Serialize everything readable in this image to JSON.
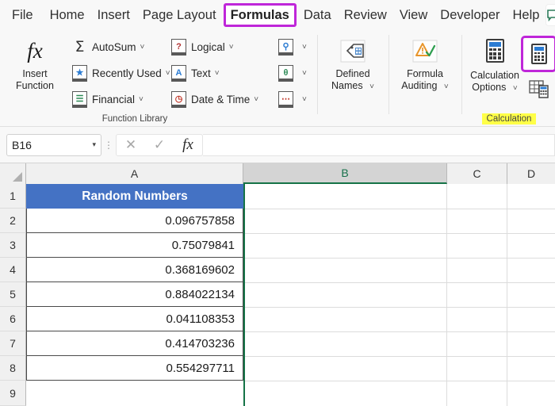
{
  "ribbon": {
    "tabs": [
      {
        "label": "File",
        "active": false
      },
      {
        "label": "Home",
        "active": false
      },
      {
        "label": "Insert",
        "active": false
      },
      {
        "label": "Page Layout",
        "active": false
      },
      {
        "label": "Formulas",
        "active": true
      },
      {
        "label": "Data",
        "active": false
      },
      {
        "label": "Review",
        "active": false
      },
      {
        "label": "View",
        "active": false
      },
      {
        "label": "Developer",
        "active": false
      },
      {
        "label": "Help",
        "active": false
      }
    ],
    "comment_icon": "comment-icon",
    "groups": {
      "function_library": {
        "label": "Function Library",
        "insert_function": {
          "line1": "Insert",
          "line2": "Function",
          "icon": "fx-icon"
        },
        "items": [
          {
            "label": "AutoSum",
            "icon": "autosum-sigma-icon",
            "chevron": "˅"
          },
          {
            "label": "Recently Used",
            "icon": "recently-used-icon",
            "chevron": "˅"
          },
          {
            "label": "Financial",
            "icon": "financial-icon",
            "chevron": "˅"
          },
          {
            "label": "Logical",
            "icon": "logical-icon",
            "chevron": "˅"
          },
          {
            "label": "Text",
            "icon": "text-icon",
            "chevron": "˅"
          },
          {
            "label": "Date & Time",
            "icon": "date-time-icon",
            "chevron": "˅"
          }
        ],
        "icon_only": [
          {
            "icon": "lookup-reference-icon",
            "chevron": "˅"
          },
          {
            "icon": "math-trig-icon",
            "chevron": "˅"
          },
          {
            "icon": "more-functions-icon",
            "chevron": "˅"
          }
        ]
      },
      "defined_names": {
        "line1": "Defined",
        "line2": "Names",
        "chevron": "˅",
        "icon": "defined-names-icon"
      },
      "formula_auditing": {
        "line1": "Formula",
        "line2": "Auditing",
        "chevron": "˅",
        "icon": "formula-auditing-icon"
      },
      "calculation": {
        "label": "Calculation",
        "options": {
          "line1": "Calculation",
          "line2": "Options",
          "chevron": "˅",
          "icon": "calculator-icon"
        },
        "calculate_now": {
          "icon": "calculate-now-icon",
          "highlighted": true
        },
        "calculate_sheet": {
          "icon": "calculate-sheet-icon"
        }
      }
    }
  },
  "formula_bar": {
    "name_box_value": "B16",
    "name_box_arrow": "▾",
    "cancel_icon": "✕",
    "enter_icon": "✓",
    "fx_icon": "fx",
    "formula_value": "",
    "formula_placeholder": ""
  },
  "sheet": {
    "columns": [
      {
        "label": "A",
        "selected": false
      },
      {
        "label": "B",
        "selected": true
      },
      {
        "label": "C",
        "selected": false
      },
      {
        "label": "D",
        "selected": false
      }
    ],
    "rows": [
      "1",
      "2",
      "3",
      "4",
      "5",
      "6",
      "7",
      "8",
      "9"
    ],
    "column_a": {
      "header": "Random Numbers",
      "values": [
        "0.096757858",
        "0.75079841",
        "0.368169602",
        "0.884022134",
        "0.041108353",
        "0.414703236",
        "0.554297711"
      ]
    }
  },
  "colors": {
    "header_fill": "#4472C4",
    "highlight_purple": "#BF26D9",
    "highlight_yellow": "#FFFF47",
    "selection_green": "#157347"
  }
}
